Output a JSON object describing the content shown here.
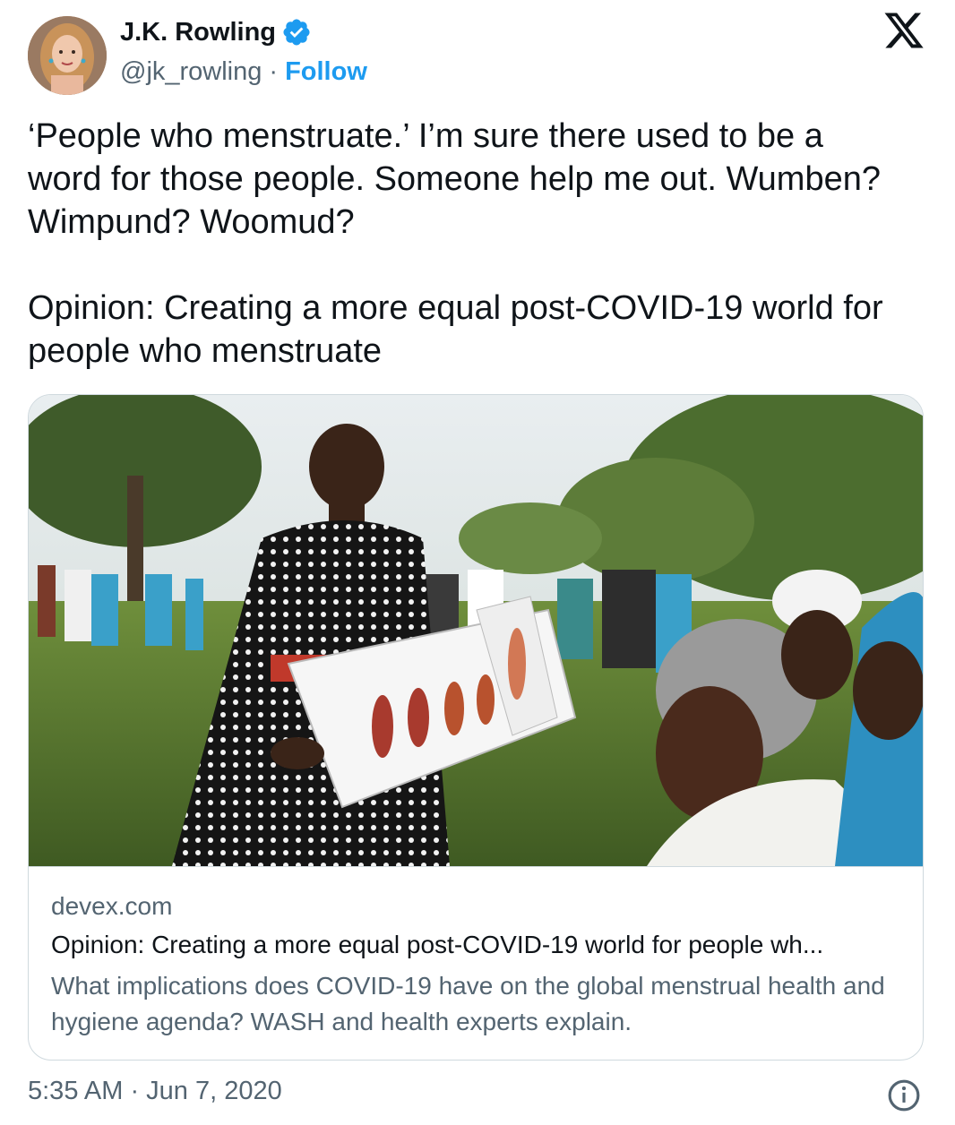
{
  "author": {
    "name": "J.K. Rowling",
    "handle": "@jk_rowling",
    "separator": "·",
    "follow_label": "Follow",
    "avatar_icon": "profile-photo",
    "verified_icon": "verified-badge-icon"
  },
  "platform_logo": "x-logo-icon",
  "tweet": {
    "text": "‘People who menstruate.’ I’m sure there used to be a\nword for those people. Someone help me out. Wumben?\nWimpund? Woomud?\n\nOpinion: Creating a more equal post-COVID-19 world for\npeople who menstruate"
  },
  "link_card": {
    "image_icon": "photo-woman-presenting-chart",
    "domain": "devex.com",
    "title": "Opinion: Creating a more equal post-COVID-19 world for people wh...",
    "description": "What implications does COVID-19 have on the global menstrual health and hygiene agenda? WASH and health experts explain."
  },
  "footer": {
    "timestamp": "5:35 AM · Jun 7, 2020",
    "info_icon": "info-icon"
  },
  "colors": {
    "text_primary": "#0f1419",
    "text_secondary": "#536471",
    "accent": "#1d9bf0",
    "border": "#cfd9de"
  }
}
